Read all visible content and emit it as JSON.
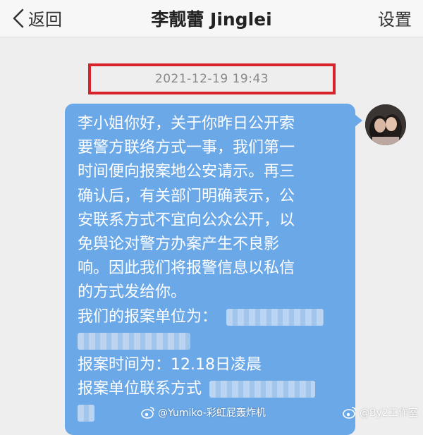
{
  "header": {
    "back_label": "返回",
    "title": "李靓蕾 Jinglei",
    "settings_label": "设置"
  },
  "chat": {
    "timestamp": "2021-12-19 19:43",
    "message_lines": [
      "李小姐你好，关于你昨日公开索",
      "要警方联络方式一事，我们第一",
      "时间便向报案地公安请示。再三",
      "确认后，有关部门明确表示，公",
      "安联系方式不宜向公众公开，以",
      "免舆论对警方办案产生不良影",
      "响。因此我们将报警信息以私信",
      "的方式发给你。",
      "我们的报案单位为：",
      "",
      "报案时间为：12.18日凌晨",
      "报案单位联系方式",
      ""
    ]
  },
  "watermarks": {
    "left": "@Yumiko-彩虹屁轰炸机",
    "right": "@By2工作室"
  },
  "colors": {
    "bubble": "#6aa8e8",
    "highlight_box": "#d8232a",
    "background": "#eeeeee"
  },
  "icons": {
    "back": "chevron-left-icon",
    "avatar": "avatar",
    "weibo": "weibo-logo-icon"
  }
}
